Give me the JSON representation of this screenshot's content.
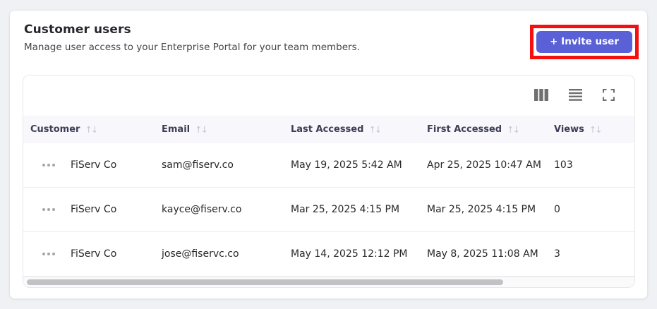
{
  "card": {
    "title": "Customer users",
    "subtitle": "Manage user access to your Enterprise Portal for your team members.",
    "invite_button_label": "+ Invite user"
  },
  "toolbar": {
    "icons": [
      "column-visibility",
      "row-density",
      "fullscreen"
    ]
  },
  "table": {
    "sort_icon": "↑↓",
    "columns": [
      {
        "label": "Customer"
      },
      {
        "label": "Email"
      },
      {
        "label": "Last Accessed"
      },
      {
        "label": "First Accessed"
      },
      {
        "label": "Views"
      }
    ],
    "rows": [
      {
        "customer": "FiServ Co",
        "email": "sam@fiserv.co",
        "last_accessed": "May 19, 2025 5:42 AM",
        "first_accessed": "Apr 25, 2025 10:47 AM",
        "views": "103"
      },
      {
        "customer": "FiServ Co",
        "email": "kayce@fiserv.co",
        "last_accessed": "Mar 25, 2025 4:15 PM",
        "first_accessed": "Mar 25, 2025 4:15 PM",
        "views": "0"
      },
      {
        "customer": "FiServ Co",
        "email": "jose@fiservc.co",
        "last_accessed": "May 14, 2025 12:12 PM",
        "first_accessed": "May 8, 2025 11:08 AM",
        "views": "3"
      }
    ]
  },
  "colors": {
    "accent_button": "#5a61d6",
    "annotation_highlight": "#f4100e",
    "header_background": "#f8f8fc",
    "page_background": "#eff1f4"
  }
}
